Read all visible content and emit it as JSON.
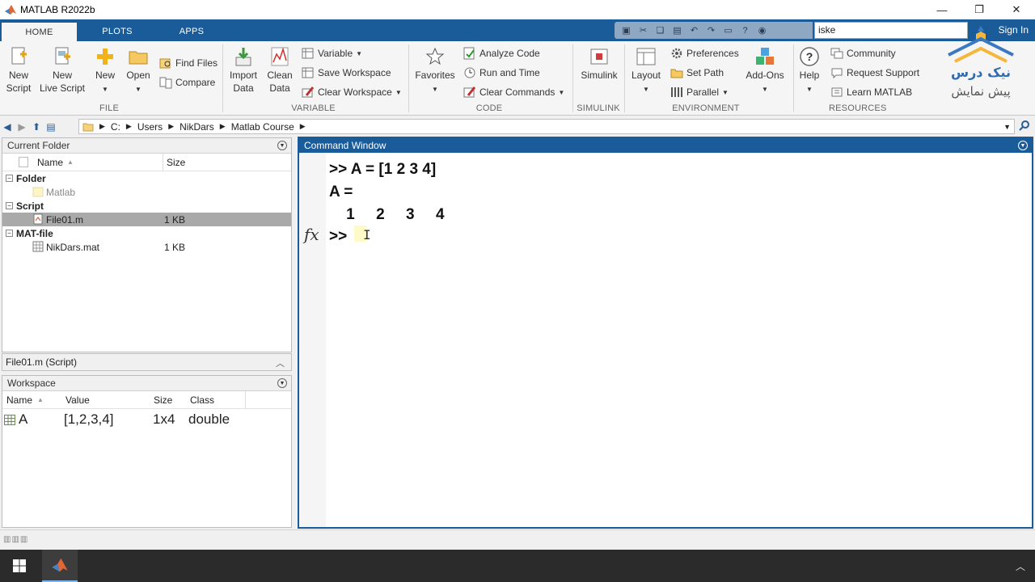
{
  "window": {
    "title": "MATLAB R2022b",
    "minimize": "—",
    "restore": "❐",
    "close": "✕"
  },
  "tabs": [
    {
      "label": "HOME"
    },
    {
      "label": "PLOTS"
    },
    {
      "label": "APPS"
    }
  ],
  "toolbar_search": {
    "value": "iske",
    "signin": "Sign In"
  },
  "ribbon": {
    "file": {
      "label": "FILE",
      "new_script": "New\nScript",
      "new_live_script": "New\nLive Script",
      "new": "New",
      "open": "Open",
      "find_files": "Find Files",
      "compare": "Compare"
    },
    "variable": {
      "label": "VARIABLE",
      "import_data": "Import\nData",
      "clean_data": "Clean\nData",
      "variable": "Variable",
      "save_workspace": "Save Workspace",
      "clear_workspace": "Clear Workspace"
    },
    "code": {
      "label": "CODE",
      "favorites": "Favorites",
      "analyze_code": "Analyze Code",
      "run_and_time": "Run and Time",
      "clear_commands": "Clear Commands"
    },
    "simulink": {
      "label": "SIMULINK",
      "simulink": "Simulink"
    },
    "environment": {
      "label": "ENVIRONMENT",
      "layout": "Layout",
      "preferences": "Preferences",
      "set_path": "Set Path",
      "parallel": "Parallel",
      "add_ons": "Add-Ons"
    },
    "resources": {
      "label": "RESOURCES",
      "help": "Help",
      "community": "Community",
      "request_support": "Request Support",
      "learn_matlab": "Learn MATLAB"
    }
  },
  "address": {
    "parts": [
      "C:",
      "Users",
      "NikDars",
      "Matlab Course"
    ]
  },
  "current_folder": {
    "title": "Current Folder",
    "columns": {
      "name": "Name",
      "size": "Size"
    },
    "groups": [
      {
        "label": "Folder",
        "items": [
          {
            "name": "Matlab",
            "size": ""
          }
        ]
      },
      {
        "label": "Script",
        "items": [
          {
            "name": "File01.m",
            "size": "1 KB"
          }
        ]
      },
      {
        "label": "MAT-file",
        "items": [
          {
            "name": "NikDars.mat",
            "size": "1 KB"
          }
        ]
      }
    ]
  },
  "details": {
    "text": "File01.m  (Script)"
  },
  "workspace": {
    "title": "Workspace",
    "columns": {
      "name": "Name",
      "value": "Value",
      "size": "Size",
      "class": "Class"
    },
    "rows": [
      {
        "name": "A",
        "value": "[1,2,3,4]",
        "size": "1x4",
        "class": "double"
      }
    ]
  },
  "command_window": {
    "title": "Command Window",
    "lines": [
      ">> A = [1 2 3 4]",
      "A =",
      "    1     2     3     4"
    ],
    "prompt": ">>",
    "fx": "fx"
  },
  "watermark": {
    "line1": "نیک درس",
    "line2": "پیش نمایش"
  },
  "colors": {
    "accent": "#195c99",
    "selection": "#a9a9a9",
    "cursor_bg": "#fffbc8"
  }
}
